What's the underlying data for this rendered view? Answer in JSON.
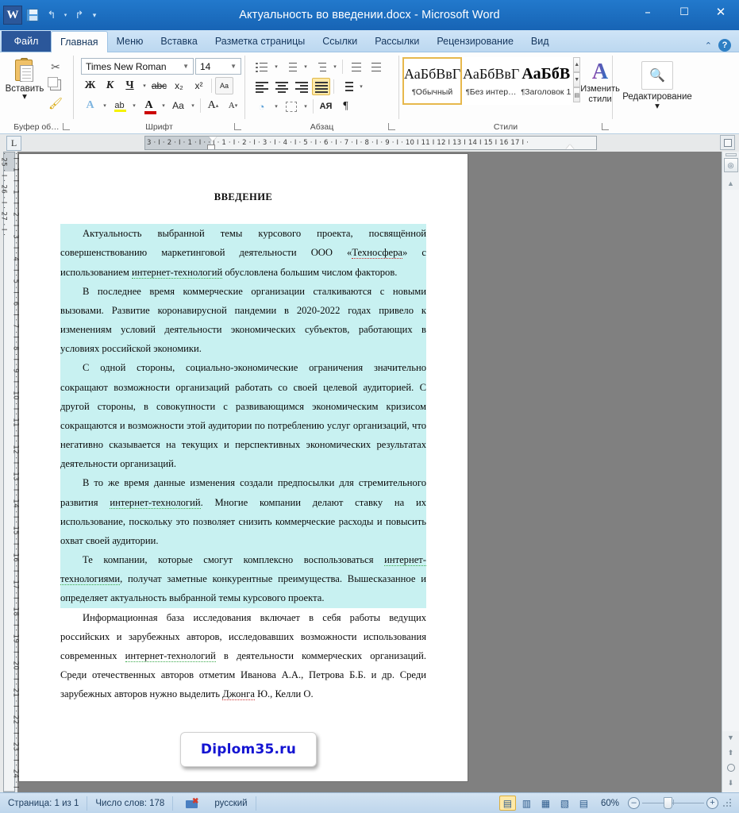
{
  "window": {
    "title": "Актуальность во введении.docx  -  Microsoft Word",
    "minimize": "–",
    "maximize": "☐",
    "close": "✕",
    "logo_letter": "W"
  },
  "quick_access": {
    "save": "save-icon",
    "undo": "↰",
    "redo": "↱",
    "customize": "▾"
  },
  "tabs": {
    "file": "Файл",
    "items": [
      {
        "label": "Главная",
        "active": true
      },
      {
        "label": "Меню",
        "active": false
      },
      {
        "label": "Вставка",
        "active": false
      },
      {
        "label": "Разметка страницы",
        "active": false
      },
      {
        "label": "Ссылки",
        "active": false
      },
      {
        "label": "Рассылки",
        "active": false
      },
      {
        "label": "Рецензирование",
        "active": false
      },
      {
        "label": "Вид",
        "active": false
      }
    ],
    "help": "?"
  },
  "ribbon": {
    "clipboard": {
      "group_label": "Буфер об…",
      "paste_label": "Вставить",
      "cut": "✂",
      "copy": "copy-icon",
      "format_painter": "🖌"
    },
    "font": {
      "group_label": "Шрифт",
      "font_name": "Times New Roman",
      "font_size": "14",
      "bold": "Ж",
      "italic": "К",
      "underline": "Ч",
      "strikethrough": "abc",
      "subscript": "x₂",
      "superscript": "x²",
      "clear_format": "Аа",
      "text_effects": "A",
      "highlight": "ab",
      "font_color": "A",
      "change_case": "Aa",
      "grow_font": "A",
      "shrink_font": "A"
    },
    "paragraph": {
      "group_label": "Абзац",
      "bullets": "bullet-list-icon",
      "numbering": "numbered-list-icon",
      "multilevel": "multilevel-list-icon",
      "decrease_indent": "decrease-indent-icon",
      "increase_indent": "increase-indent-icon",
      "align_left": "align-left-icon",
      "align_center": "align-center-icon",
      "align_right": "align-right-icon",
      "align_justify": "align-justify-icon",
      "line_spacing": "line-spacing-icon",
      "shading": "shading-icon",
      "borders": "borders-icon",
      "sort": "AЯ",
      "show_marks": "¶"
    },
    "styles": {
      "group_label": "Стили",
      "items": [
        {
          "preview": "АаБбВвГ",
          "name": "Обычный",
          "active": true
        },
        {
          "preview": "АаБбВвГ",
          "name": "Без интер…",
          "active": false
        },
        {
          "preview": "АаБбВ",
          "name": "Заголовок 1",
          "active": false
        }
      ],
      "change_styles": "Изменить стили"
    },
    "editing": {
      "group_label": "Редактирование",
      "icon": "binoculars-icon"
    }
  },
  "ruler": {
    "tab_selector": "L",
    "horizontal_marks": "3 · I · 2 · I · 1 · I ·  · I · 1 · I · 2 · I · 3 · I · 4 · I · 5 · I · 6 · I · 7 · I · 8 · I · 9 · I · 10 I 11 I 12 I 13 I 14 I 15 I 16  17 I ·",
    "vertical_marks": "· I · 1 · I · 1 · I · 2 · I · 3 · I · 4 · I · 5 · I · 6 · I · 7 · I · 8 · I · 9 · I · 10 · I · 11 · I · 12 · I · 13 · I · 14 · I · 15 · I · 16 · I · 17 · I · 18 · I · 19 · I · 20 · I · 21 · I · 22 · I · 23 · I · 24 · I · 25 · I · 26 · I · 27 · I ·"
  },
  "document": {
    "heading": "ВВЕДЕНИЕ",
    "paragraphs": [
      {
        "highlighted": true,
        "text": "Актуальность выбранной темы курсового проекта, посвящённой совершенствованию маркетинговой деятельности ООО «Техносфера» с использованием интернет-технологий обусловлена большим числом факторов."
      },
      {
        "highlighted": true,
        "text": "В последнее время коммерческие организации сталкиваются с новыми вызовами. Развитие коронавирусной пандемии в 2020-2022 годах привело к изменениям условий деятельности экономических субъектов, работающих в условиях российской экономики."
      },
      {
        "highlighted": true,
        "text": "С одной стороны, социально-экономические ограничения значительно сокращают возможности организаций работать со своей целевой аудиторией. С другой стороны, в совокупности с развивающимся экономическим кризисом сокращаются и возможности этой аудитории по потреблению услуг организаций, что негативно сказывается на текущих и перспективных экономических результатах деятельности организаций."
      },
      {
        "highlighted": true,
        "text": "В то же время данные изменения создали предпосылки для стремительного развития интернет-технологий. Многие компании делают ставку на их использование, поскольку это позволяет снизить коммерческие расходы и повысить охват своей аудитории."
      },
      {
        "highlighted": true,
        "text": "Те компании, которые смогут комплексно воспользоваться интернет-технологиями, получат заметные конкурентные преимущества. Вышесказанное и определяет актуальность выбранной темы курсового проекта."
      },
      {
        "highlighted": false,
        "text": "Информационная база исследования включает в себя работы ведущих российских и зарубежных авторов, исследовавших возможности использования современных интернет-технологий в деятельности коммерческих организаций. Среди отечественных авторов отметим Иванова А.А., Петрова Б.Б. и др. Среди зарубежных авторов нужно выделить Джонга Ю., Келли О."
      }
    ],
    "watermark": "Diplom35.ru"
  },
  "status_bar": {
    "page": "Страница: 1 из 1",
    "word_count": "Число слов: 178",
    "language": "русский",
    "proofing_icon": "proofing-errors-icon",
    "view_buttons": [
      {
        "name": "print-layout",
        "glyph": "▤",
        "active": true
      },
      {
        "name": "full-screen-reading",
        "glyph": "▥",
        "active": false
      },
      {
        "name": "web-layout",
        "glyph": "▦",
        "active": false
      },
      {
        "name": "outline",
        "glyph": "▧",
        "active": false
      },
      {
        "name": "draft",
        "glyph": "▤",
        "active": false
      }
    ],
    "zoom": "60%",
    "zoom_out": "–",
    "zoom_in": "+"
  }
}
